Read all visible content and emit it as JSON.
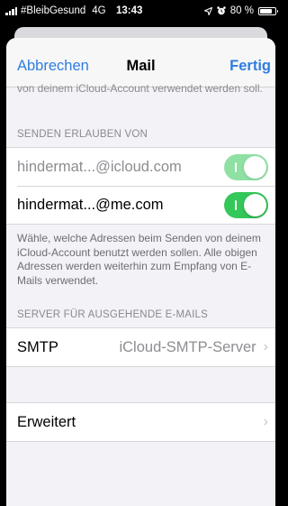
{
  "status_bar": {
    "carrier": "#BleibGesund",
    "network": "4G",
    "time": "13:43",
    "battery": "80 %",
    "battery_level": 0.8
  },
  "nav": {
    "cancel_label": "Abbrechen",
    "title": "Mail",
    "done_label": "Fertig"
  },
  "top_footnote": "von deinem iCloud-Account verwendet werden soll.",
  "send_from": {
    "header": "SENDEN ERLAUBEN VON",
    "items": [
      {
        "address": "hindermat...@icloud.com",
        "enabled": true,
        "locked": true
      },
      {
        "address": "hindermat...@me.com",
        "enabled": true,
        "locked": false
      }
    ],
    "footnote": "Wähle, welche Adressen beim Senden von deinem iCloud-Account benutzt werden sollen. Alle obigen Adressen werden weiterhin zum Empfang von E-Mails verwendet."
  },
  "outgoing": {
    "header": "SERVER FÜR AUSGEHENDE E-MAILS",
    "smtp_label": "SMTP",
    "smtp_value": "iCloud-SMTP-Server"
  },
  "advanced": {
    "label": "Erweitert"
  },
  "colors": {
    "accent": "#2f7de1",
    "toggle_on": "#34c759"
  }
}
